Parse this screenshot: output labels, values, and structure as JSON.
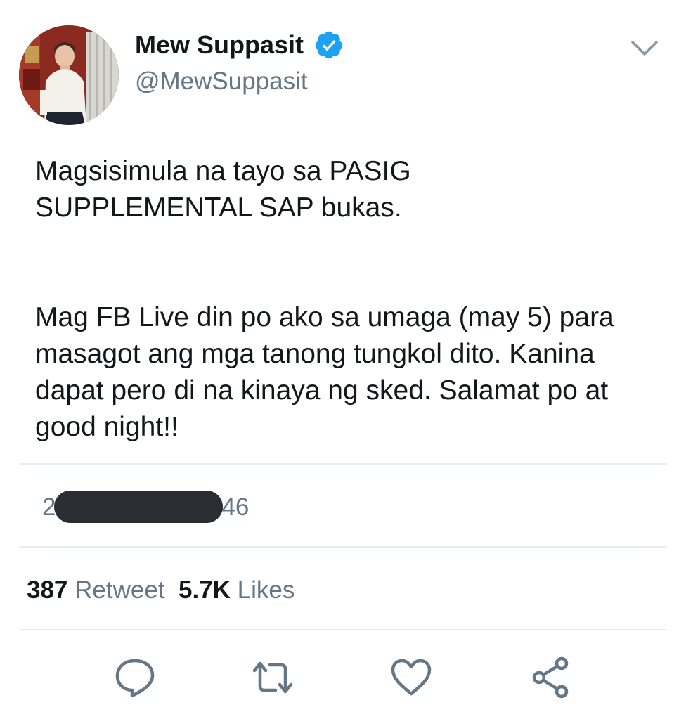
{
  "tweet": {
    "author": {
      "display_name": "Mew Suppasit",
      "handle": "@MewSuppasit",
      "verified": true
    },
    "text": {
      "paragraph_1_line_1": "Magsisimula na tayo sa PASIG",
      "paragraph_1_line_2": "SUPPLEMENTAL SAP bukas.",
      "paragraph_2_line_1": "Mag FB Live din po ako sa umaga (may 5) para",
      "paragraph_2_line_2": "masagot ang mga tanong tungkol dito. Kanina",
      "paragraph_2_line_3": "dapat pero di na kinaya ng sked. Salamat po at",
      "paragraph_2_line_4": "good night!!"
    },
    "timestamp": {
      "visible_prefix": "2",
      "visible_suffix": "46"
    },
    "stats": {
      "retweet_count": "387",
      "retweet_label": "Retweet",
      "likes_count": "5.7K",
      "likes_label": "Likes"
    },
    "actions": [
      {
        "icon": "reply-icon"
      },
      {
        "icon": "retweet-icon"
      },
      {
        "icon": "like-heart-icon"
      },
      {
        "icon": "share-icon"
      }
    ]
  },
  "colors": {
    "text_primary": "#14171a",
    "text_secondary": "#657786",
    "verified_blue": "#1da1f2",
    "divider": "#e6ecf0",
    "redaction": "#2a2e33"
  }
}
